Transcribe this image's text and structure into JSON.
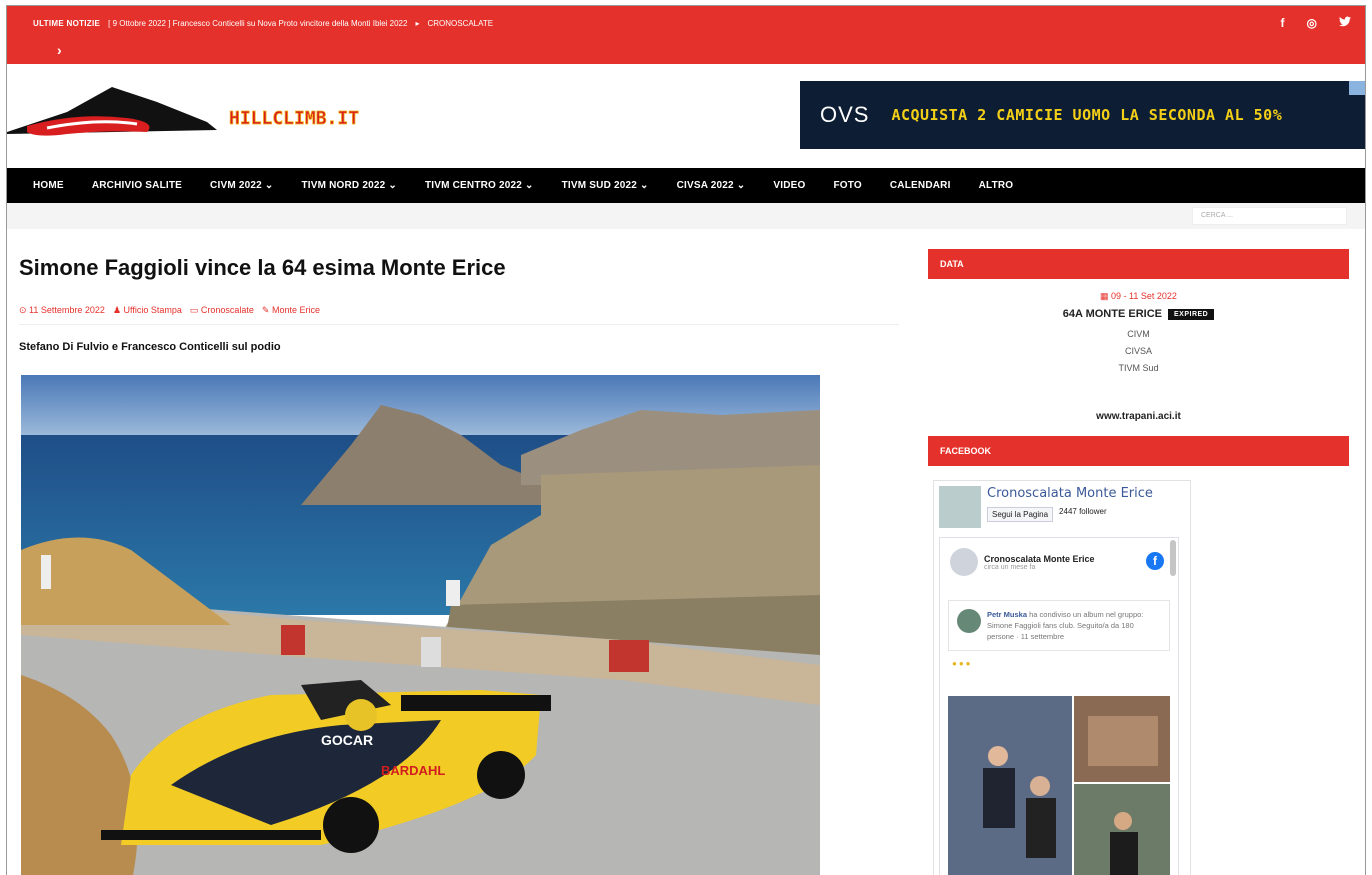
{
  "topbar": {
    "label": "ULTIME NOTIZIE",
    "ticker": "[ 9 Ottobre 2022 ] Francesco Conticelli su Nova Proto vincitore della Monti Iblei 2022",
    "ticker_category": "CRONOSCALATE",
    "next_arrow": "›",
    "social": [
      "f",
      "◎",
      "🐦"
    ]
  },
  "header": {
    "logo_text": "HILLCLIMB.IT",
    "ad_brand": "OVS",
    "ad_text": "ACQUISTA 2 CAMICIE UOMO LA SECONDA AL 50%"
  },
  "nav": {
    "items": [
      "HOME",
      "ARCHIVIO SALITE",
      "CIVM 2022 ⌄",
      "TIVM NORD 2022 ⌄",
      "TIVM CENTRO 2022 ⌄",
      "TIVM SUD 2022 ⌄",
      "CIVSA 2022 ⌄",
      "VIDEO",
      "FOTO",
      "CALENDARI",
      "ALTRO"
    ],
    "search_placeholder": "CERCA ..."
  },
  "article": {
    "title": "Simone Faggioli vince la 64 esima Monte Erice",
    "date": "⊙ 11 Settembre 2022",
    "author": "♟ Ufficio Stampa",
    "category": "▭ Cronoscalate",
    "tag": "✎ Monte Erice",
    "subtitle": "Stefano Di Fulvio e Francesco Conticelli sul podio"
  },
  "sidebar": {
    "data_title": "DATA",
    "event_date": "▦ 09 - 11 Set 2022",
    "event_name": "64A MONTE ERICE",
    "event_badge": "EXPIRED",
    "categories": [
      "CIVM",
      "CIVSA",
      "TIVM Sud"
    ],
    "website": "www.trapani.aci.it",
    "facebook_title": "FACEBOOK",
    "fb_page_name": "Cronoscalata Monte Erice",
    "fb_follow": "Segui la Pagina",
    "fb_followers": "2447 follower",
    "fb_post_name": "Cronoscalata Monte Erice",
    "fb_post_time": "circa un mese fa",
    "fb_share_user": "Petr Muska",
    "fb_share_text": "ha condiviso un album nel gruppo: Simone Faggioli fans club. Seguito/a da 180 persone · 11 settembre",
    "fb_emoji": "●●●"
  },
  "colors": {
    "accent": "#e5312b",
    "nav": "#000000",
    "ad_bg": "#0d1d33",
    "ad_text": "#f3cf18"
  }
}
